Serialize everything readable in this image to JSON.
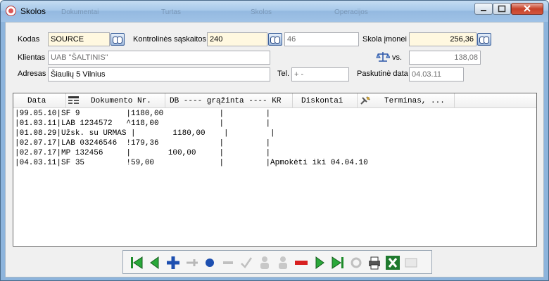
{
  "window": {
    "title": "Skolos"
  },
  "ghost_menu": [
    "Dokumentai",
    "Turtas",
    "Skolos",
    "Operacijos"
  ],
  "form": {
    "kodas_label": "Kodas",
    "kodas_value": "SOURCE",
    "kontrolines_label": "Kontrolinės sąskaitos",
    "kontrolines_value": "240",
    "kontrolines_value2": "46",
    "skola_label": "Skola įmonei",
    "skola_value": "256,36",
    "klientas_label": "Klientas",
    "klientas_value": "UAB \"ŠALTINIS\"",
    "vs_label": "vs.",
    "vs_value": "138,08",
    "adresas_label": "Adresas",
    "adresas_value": "Šiaulių 5 Vilnius",
    "tel_label": "Tel.",
    "tel_value": "+  -",
    "paskutine_label": "Paskutinė data",
    "paskutine_value": "04.03.11"
  },
  "grid": {
    "headers": [
      "Data",
      "Dokumento Nr.",
      "DB ---- grąžinta ---- KR",
      "Diskontai",
      "Terminas, ..."
    ],
    "rows": [
      "|99.05.10|SF 9          |1180,00            |         |",
      "|01.03.11|LAB 1234572   ^118,00             |         |",
      "|01.08.29|Užsk. su URMAS |        1180,00    |         |",
      "|02.07.17|LAB 03246546  !179,36             |         |",
      "|02.07.17|MP 132456     |        100,00     |         |",
      "|04.03.11|SF 35         !59,00              |         |Apmokėti iki 04.04.10"
    ]
  },
  "toolbar": {
    "buttons": [
      "first-icon",
      "prev-icon",
      "add-icon",
      "insert-icon",
      "record-icon",
      "delete-row-icon",
      "confirm-icon",
      "person-icon",
      "person2-icon",
      "remove-icon",
      "next-icon",
      "last-icon",
      "refresh-icon",
      "print-icon",
      "excel-icon",
      "export-icon"
    ]
  }
}
